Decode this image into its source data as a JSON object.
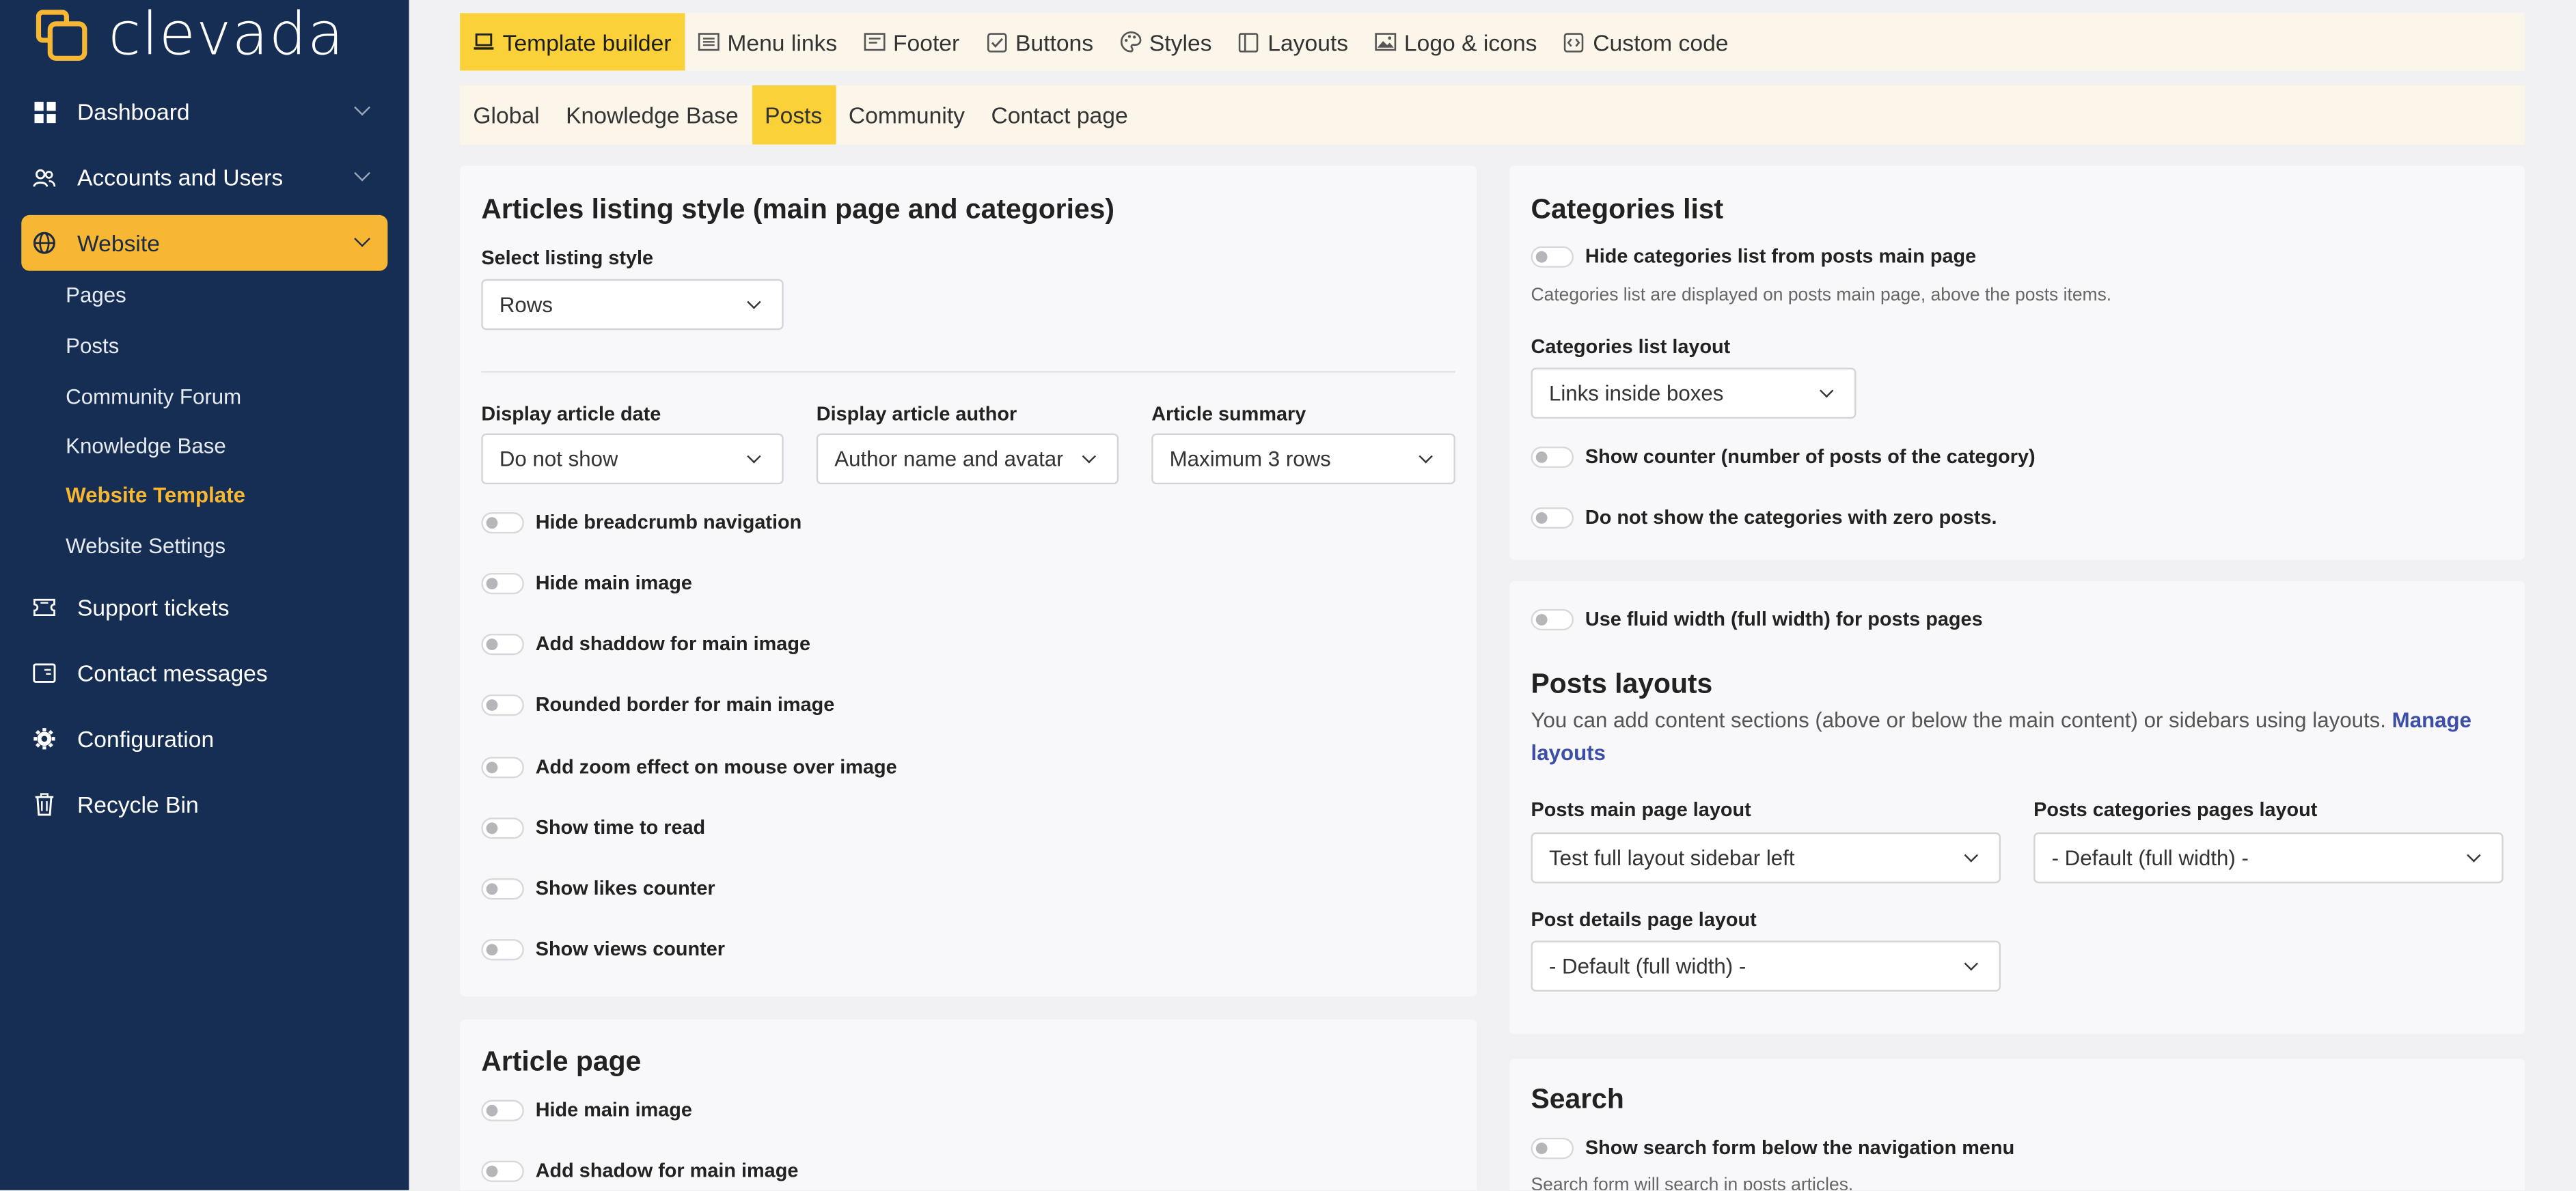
{
  "brand": {
    "name": "clevada"
  },
  "colors": {
    "sidebar": "#162e53",
    "accent": "#f7b733",
    "tab_active": "#fbd13a",
    "link": "#3c4fa8"
  },
  "sidebar": {
    "items": [
      {
        "label": "Dashboard",
        "icon": "grid-icon"
      },
      {
        "label": "Accounts and Users",
        "icon": "users-icon"
      },
      {
        "label": "Website",
        "icon": "globe-icon"
      },
      {
        "label": "Support tickets",
        "icon": "ticket-icon"
      },
      {
        "label": "Contact messages",
        "icon": "message-icon"
      },
      {
        "label": "Configuration",
        "icon": "gear-icon"
      },
      {
        "label": "Recycle Bin",
        "icon": "trash-icon"
      }
    ],
    "website_sub": [
      "Pages",
      "Posts",
      "Community Forum",
      "Knowledge Base",
      "Website Template",
      "Website Settings"
    ]
  },
  "tabs": [
    "Template builder",
    "Menu links",
    "Footer",
    "Buttons",
    "Styles",
    "Layouts",
    "Logo & icons",
    "Custom code"
  ],
  "subtabs": [
    "Global",
    "Knowledge Base",
    "Posts",
    "Community",
    "Contact page"
  ],
  "listing": {
    "title": "Articles listing style (main page and categories)",
    "style_label": "Select listing style",
    "style_value": "Rows",
    "date_label": "Display article date",
    "date_value": "Do not show",
    "author_label": "Display article author",
    "author_value": "Author name and avatar",
    "summary_label": "Article summary",
    "summary_value": "Maximum 3 rows",
    "toggles": [
      "Hide breadcrumb navigation",
      "Hide main image",
      "Add shaddow for main image",
      "Rounded border for main image",
      "Add zoom effect on mouse over image",
      "Show time to read",
      "Show likes counter",
      "Show views counter"
    ]
  },
  "article_page": {
    "title": "Article page",
    "toggles": [
      "Hide main image",
      "Add shadow for main image"
    ]
  },
  "categories": {
    "title": "Categories list",
    "hide_toggle": "Hide categories list from posts main page",
    "hint": "Categories list are displayed on posts main page, above the posts items.",
    "layout_label": "Categories list layout",
    "layout_value": "Links inside boxes",
    "counter_toggle": "Show counter (number of posts of the category)",
    "zero_toggle": "Do not show the categories with zero posts."
  },
  "posts_layouts": {
    "fluid_toggle": "Use fluid width (full width) for posts pages",
    "title": "Posts layouts",
    "description": "You can add content sections (above or below the main content) or sidebars using layouts.",
    "manage_link": "Manage layouts",
    "main_label": "Posts main page layout",
    "main_value": "Test full layout sidebar left",
    "cat_label": "Posts categories pages layout",
    "cat_value": "- Default (full width) -",
    "details_label": "Post details page layout",
    "details_value": "- Default (full width) -"
  },
  "search": {
    "title": "Search",
    "toggle": "Show search form below the navigation menu",
    "hint": "Search form will search in posts articles."
  }
}
